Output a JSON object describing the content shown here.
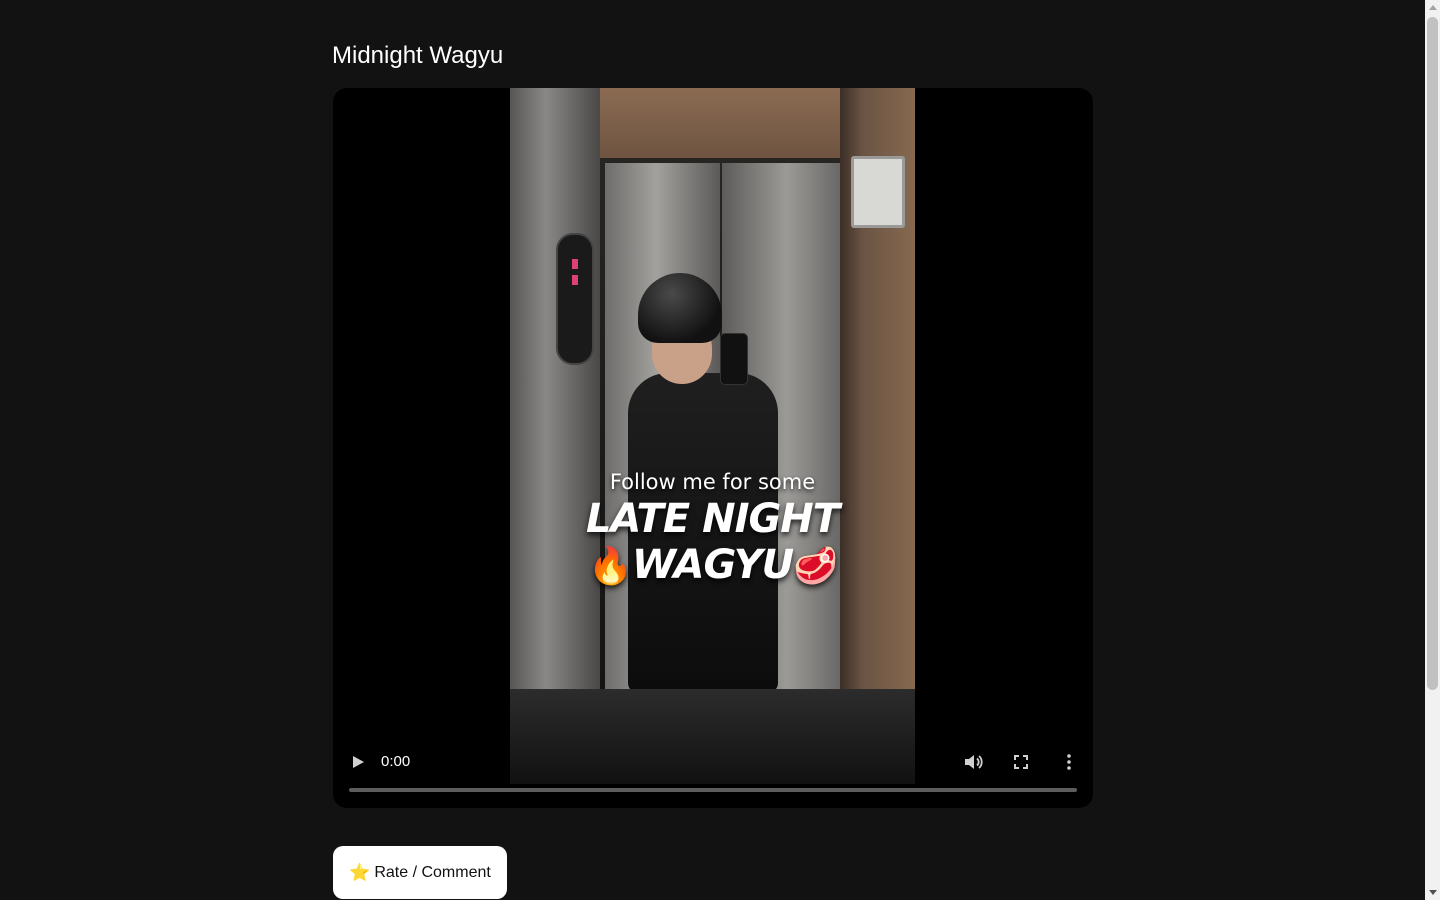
{
  "page": {
    "title": "Midnight Wagyu"
  },
  "video": {
    "overlay": {
      "line1": "Follow me for some",
      "line2": "LATE NIGHT",
      "line3_prefix_emoji": "🔥",
      "line3": "WAGYU",
      "line3_suffix_emoji": "🥩"
    },
    "current_time": "0:00",
    "progress": 0,
    "icons": {
      "play": "play-icon",
      "volume": "volume-icon",
      "fullscreen": "fullscreen-icon",
      "more": "more-options-icon"
    }
  },
  "rate_button": {
    "icon": "⭐",
    "label": "Rate / Comment"
  },
  "colors": {
    "background": "#121212",
    "button_bg": "#ffffff",
    "text": "#ffffff"
  }
}
